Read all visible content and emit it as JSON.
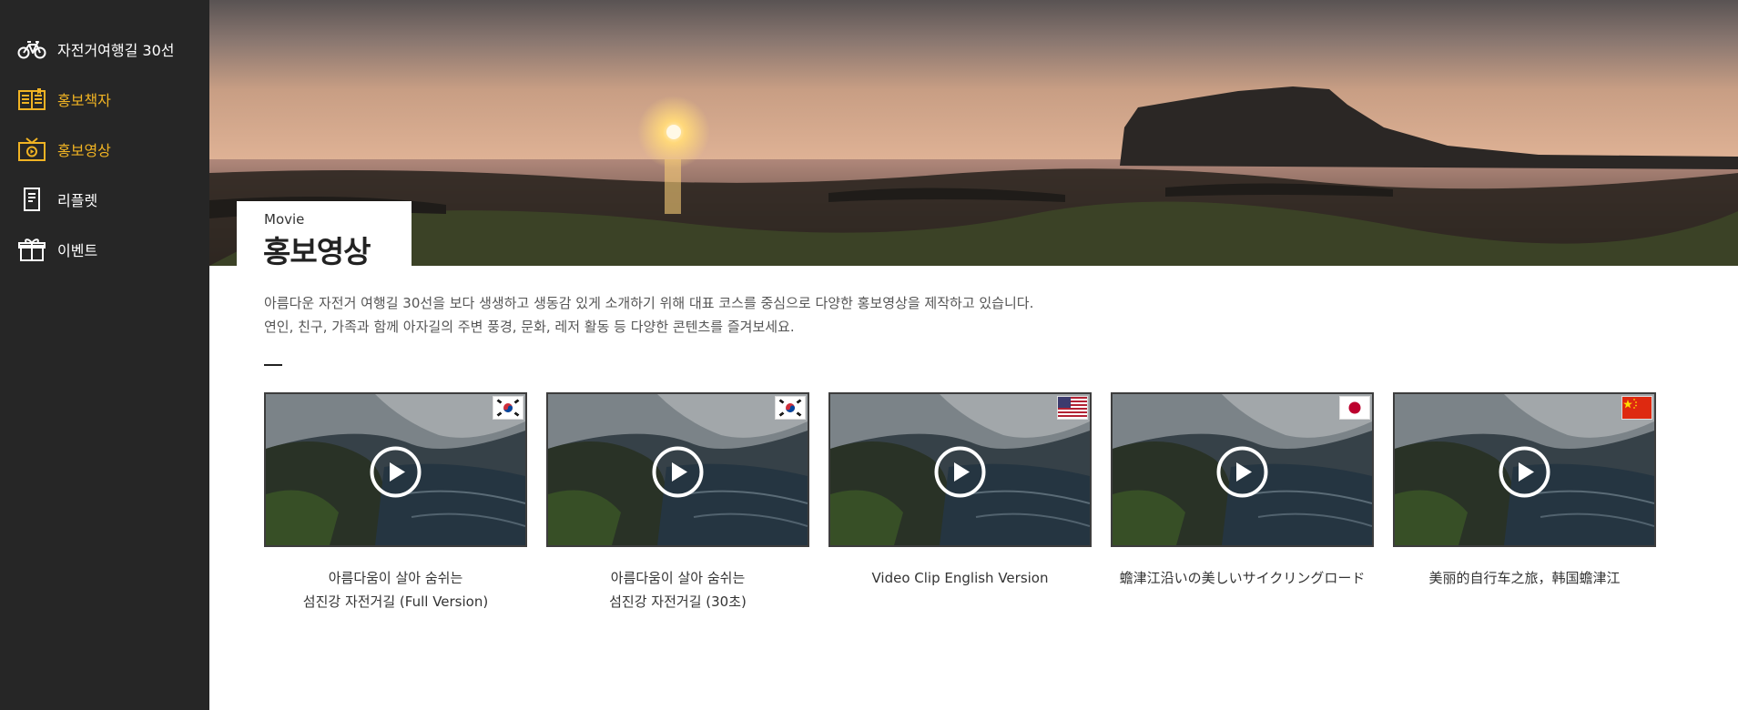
{
  "sidebar": {
    "items": [
      {
        "label": "자전거여행길 30선",
        "icon": "bicycle-icon",
        "active": false
      },
      {
        "label": "홍보책자",
        "icon": "booklet-icon",
        "active": true
      },
      {
        "label": "홍보영상",
        "icon": "tv-icon",
        "active": true
      },
      {
        "label": "리플렛",
        "icon": "leaflet-icon",
        "active": false
      },
      {
        "label": "이벤트",
        "icon": "gift-icon",
        "active": false
      }
    ],
    "accent": "#f0b323",
    "background": "#262626"
  },
  "page": {
    "subtitle": "Movie",
    "title": "홍보영상",
    "description": [
      "아름다운 자전거 여행길 30선을 보다 생생하고 생동감 있게 소개하기 위해 대표 코스를 중심으로 다양한 홍보영상을 제작하고 있습니다.",
      "연인, 친구, 가족과 함께 아자길의 주변 풍경, 문화, 레저 활동 등 다양한 콘텐츠를 즐겨보세요."
    ]
  },
  "videos": [
    {
      "flag": "korea-flag-icon",
      "title_lines": [
        "아름다움이 살아 숨쉬는",
        "섬진강 자전거길 (Full Version)"
      ]
    },
    {
      "flag": "korea-flag-icon",
      "title_lines": [
        "아름다움이 살아 숨쉬는",
        "섬진강 자전거길 (30초)"
      ]
    },
    {
      "flag": "usa-flag-icon",
      "title_lines": [
        "Video Clip English Version"
      ]
    },
    {
      "flag": "japan-flag-icon",
      "title_lines": [
        "蟾津江沿いの美しいサイクリングロード"
      ]
    },
    {
      "flag": "china-flag-icon",
      "title_lines": [
        "美丽的自行车之旅，韩国蟾津江"
      ]
    }
  ]
}
